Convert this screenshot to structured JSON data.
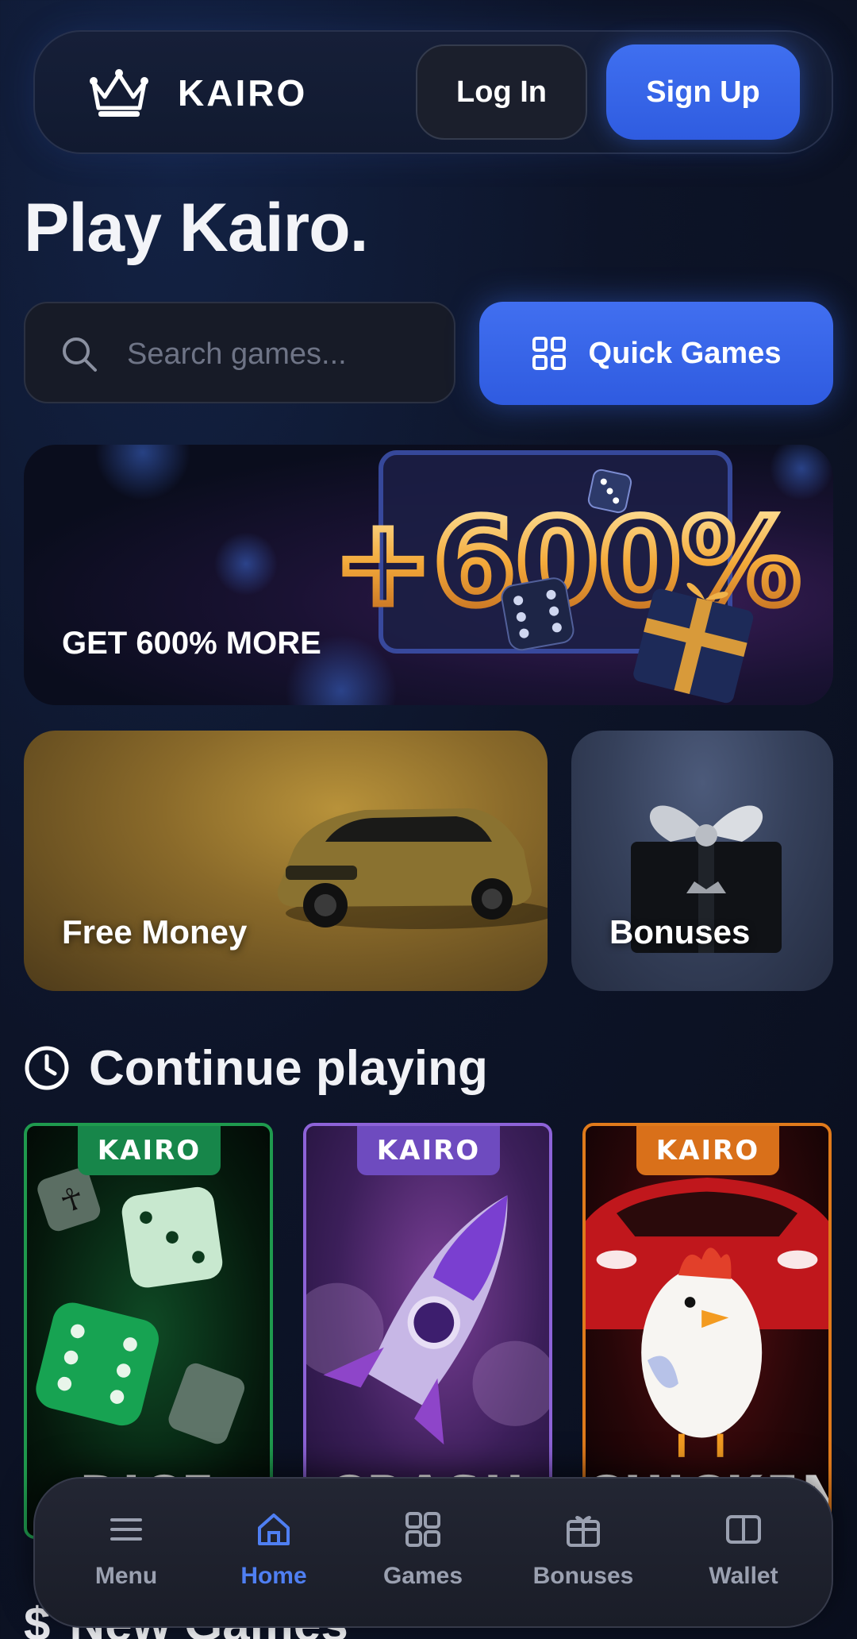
{
  "header": {
    "logo_icon": "crown-icon",
    "brand": "KAIRO",
    "login_label": "Log In",
    "signup_label": "Sign Up"
  },
  "page_title": "Play Kairo.",
  "search": {
    "placeholder": "Search games...",
    "icon": "search-icon"
  },
  "quick_games": {
    "label": "Quick Games",
    "icon": "grid-icon"
  },
  "promo": {
    "label": "GET 600% MORE",
    "art_text": "+600%"
  },
  "cards": {
    "free_money": "Free Money",
    "bonuses": "Bonuses"
  },
  "continue_section": {
    "icon": "clock-icon",
    "title": "Continue playing"
  },
  "games": [
    {
      "badge": "KAIRO",
      "name": "DICE"
    },
    {
      "badge": "KAIRO",
      "name": "CRASH"
    },
    {
      "badge": "KAIRO",
      "name": "CHICKEN"
    }
  ],
  "new_section": {
    "icon": "dollar-icon",
    "title": "New Games"
  },
  "bottom_nav": [
    {
      "label": "Menu",
      "icon": "menu-icon"
    },
    {
      "label": "Home",
      "icon": "home-icon",
      "active": true
    },
    {
      "label": "Games",
      "icon": "grid-icon"
    },
    {
      "label": "Bonuses",
      "icon": "gift-icon"
    },
    {
      "label": "Wallet",
      "icon": "wallet-icon"
    }
  ],
  "colors": {
    "accent": "#3a66ea",
    "background": "#0c1224",
    "active_nav": "#4f7ff2",
    "dice_border": "#1f9a4e",
    "crash_border": "#8d63d8",
    "chicken_border": "#e07a1b"
  }
}
